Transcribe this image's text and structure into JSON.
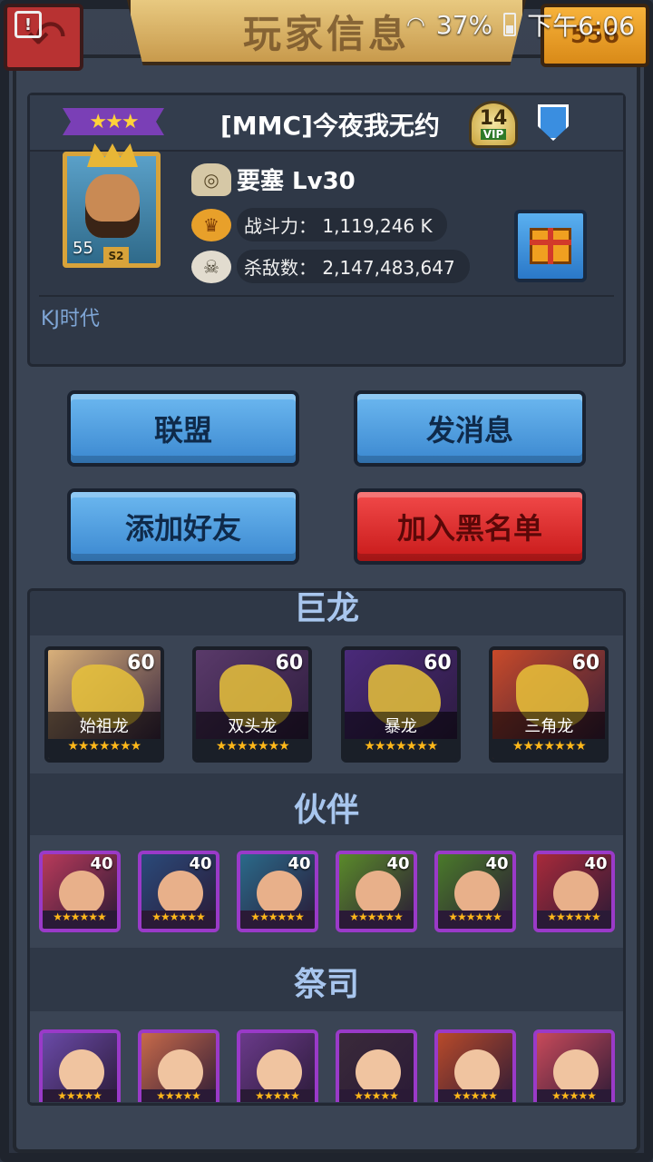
{
  "status_bar": {
    "battery_percent": "37%",
    "time": "下午6:06"
  },
  "header": {
    "title": "玩家信息",
    "gold_amount": "556"
  },
  "player": {
    "stars": "★★★",
    "name": "[MMC]今夜我无约",
    "vip_level": "14",
    "vip_label": "VIP",
    "avatar_level": "55",
    "avatar_season": "S2",
    "fortress": "要塞 Lv30",
    "power_label": "战斗力：",
    "power_value": "1,119,246 K",
    "kills_label": "杀敌数：",
    "kills_value": "2,147,483,647",
    "alliance": "KJ时代"
  },
  "actions": {
    "alliance_button": "联盟",
    "message_button": "发消息",
    "add_friend_button": "添加好友",
    "blacklist_button": "加入黑名单"
  },
  "sections": {
    "dragons_title": "巨龙",
    "partners_title": "伙伴",
    "priests_title": "祭司"
  },
  "dragons": [
    {
      "name": "始祖龙",
      "level": "60",
      "stars": "★★★★★★★",
      "color": "#d9b07a"
    },
    {
      "name": "双头龙",
      "level": "60",
      "stars": "★★★★★★★",
      "color": "#5a3a6a"
    },
    {
      "name": "暴龙",
      "level": "60",
      "stars": "★★★★★★★",
      "color": "#4a2a7a"
    },
    {
      "name": "三角龙",
      "level": "60",
      "stars": "★★★★★★★",
      "color": "#c84a2a"
    }
  ],
  "partners": [
    {
      "level": "40",
      "stars": "★★★★★★",
      "color": "#b83a5a"
    },
    {
      "level": "40",
      "stars": "★★★★★★",
      "color": "#2a4a7a"
    },
    {
      "level": "40",
      "stars": "★★★★★★",
      "color": "#2a6a8a"
    },
    {
      "level": "40",
      "stars": "★★★★★★",
      "color": "#5a8a2a"
    },
    {
      "level": "40",
      "stars": "★★★★★★",
      "color": "#4a7a2a"
    },
    {
      "level": "40",
      "stars": "★★★★★★",
      "color": "#a82a3a"
    }
  ],
  "priests": [
    {
      "stars": "★★★★★",
      "color": "#6a4aa8"
    },
    {
      "stars": "★★★★★",
      "color": "#c86a4a"
    },
    {
      "stars": "★★★★★",
      "color": "#6a3a8a"
    },
    {
      "stars": "★★★★★",
      "color": "#3a2a3a"
    },
    {
      "stars": "★★★★★",
      "color": "#b84a2a"
    },
    {
      "stars": "★★★★★",
      "color": "#c84a5a"
    }
  ]
}
